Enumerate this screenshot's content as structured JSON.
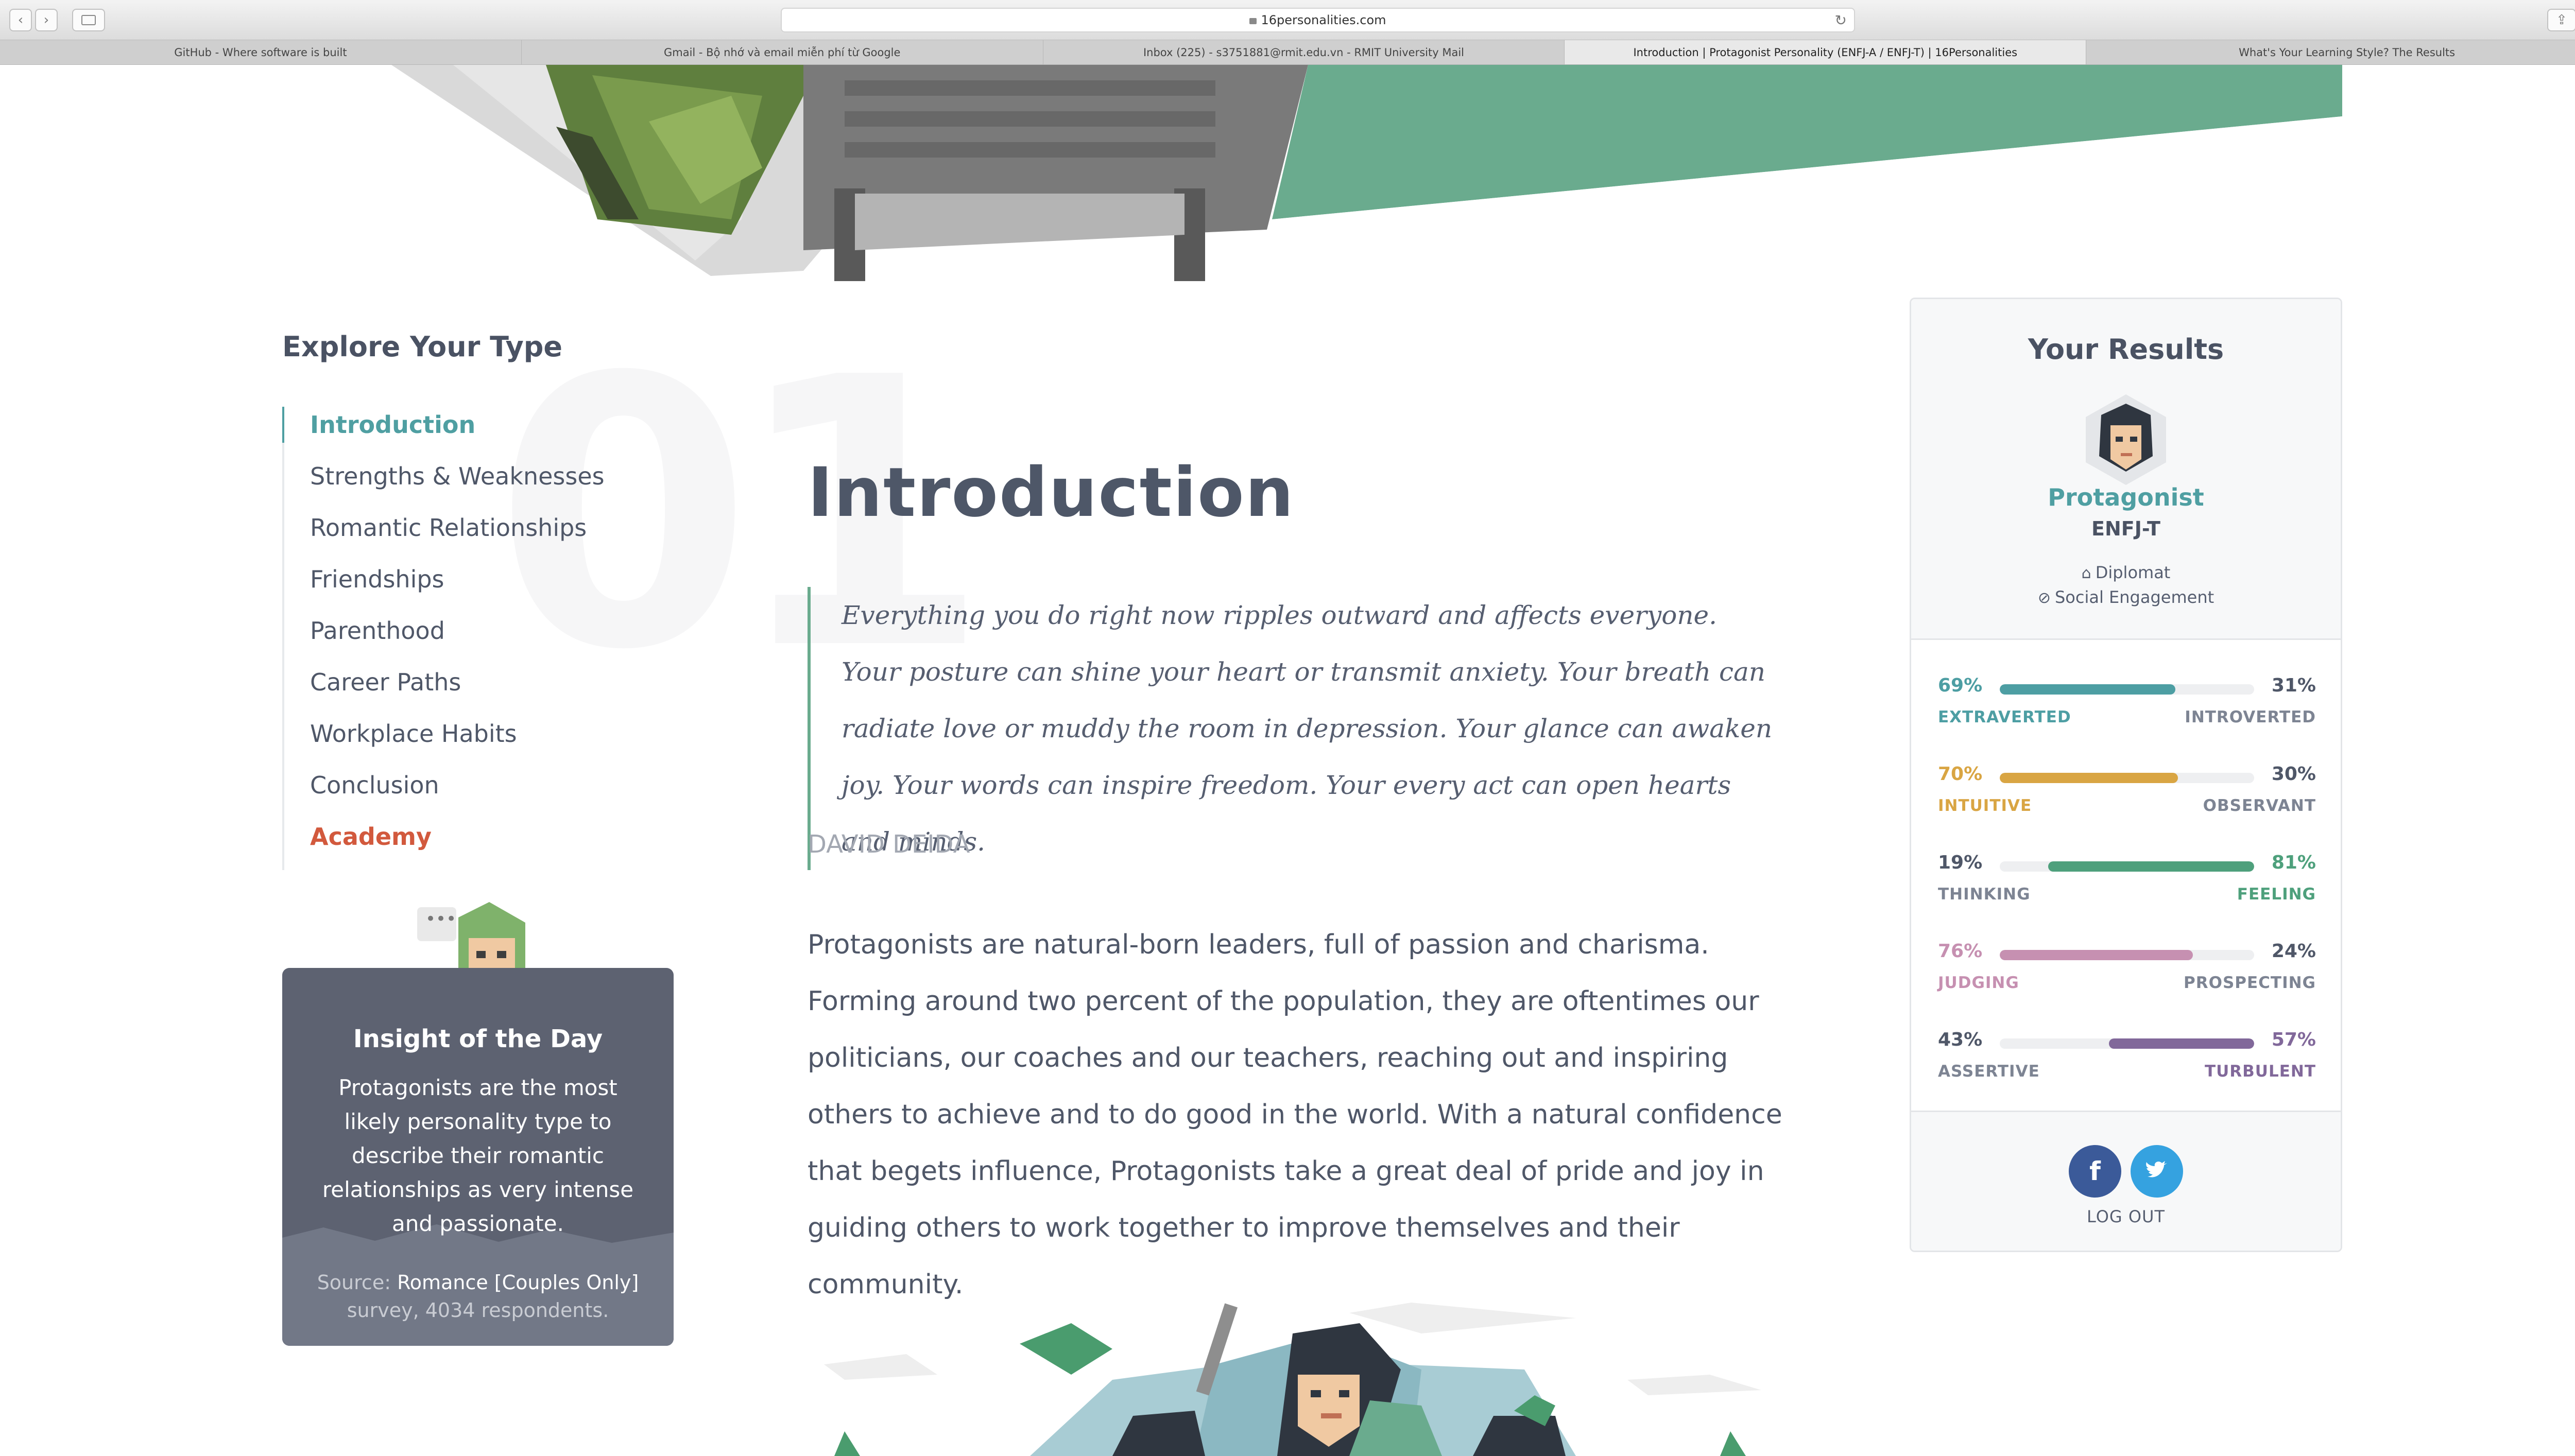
{
  "browser": {
    "url": "16personalities.com",
    "tabs": [
      {
        "label": "GitHub - Where software is built",
        "active": false
      },
      {
        "label": "Gmail - Bộ nhớ và email miễn phí từ Google",
        "active": false
      },
      {
        "label": "Inbox (225) - s3751881@rmit.edu.vn - RMIT University Mail",
        "active": false
      },
      {
        "label": "Introduction | Protagonist Personality (ENFJ-A / ENFJ-T) | 16Personalities",
        "active": true
      },
      {
        "label": "What's Your Learning Style? The Results",
        "active": false
      }
    ],
    "new_tab_label": "+"
  },
  "sidebar": {
    "title": "Explore Your Type",
    "section_number": "01",
    "items": [
      {
        "label": "Introduction",
        "active": true
      },
      {
        "label": "Strengths & Weaknesses"
      },
      {
        "label": "Romantic Relationships"
      },
      {
        "label": "Friendships"
      },
      {
        "label": "Parenthood"
      },
      {
        "label": "Career Paths"
      },
      {
        "label": "Workplace Habits"
      },
      {
        "label": "Conclusion"
      },
      {
        "label": "Academy",
        "accent": true
      }
    ]
  },
  "insight": {
    "title": "Insight of the Day",
    "text": "Protagonists are the most likely personality type to describe their romantic relationships as very intense and passionate.",
    "source_prefix": "Source:",
    "source_link": "Romance [Couples Only]",
    "source_suffix": "survey, 4034 respondents."
  },
  "main": {
    "title": "Introduction",
    "quote": "Everything you do right now ripples outward and affects everyone. Your posture can shine your heart or transmit anxiety. Your breath can radiate love or muddy the room in depression. Your glance can awaken joy. Your words can inspire freedom. Your every act can open hearts and minds.",
    "quote_author": "DAVID DEIDA",
    "body": "Protagonists are natural-born leaders, full of passion and charisma. Forming around two percent of the population, they are oftentimes our politicians, our coaches and our teachers, reaching out and inspiring others to achieve and to do good in the world. With a natural confidence that begets influence, Protagonists take a great deal of pride and joy in guiding others to work together to improve themselves and their community."
  },
  "results": {
    "title": "Your Results",
    "type_name": "Protagonist",
    "type_code": "ENFJ-T",
    "role": "Diplomat",
    "strategy": "Social Engagement",
    "traits": [
      {
        "left_pct": "69%",
        "right_pct": "31%",
        "left_label": "EXTRAVERTED",
        "right_label": "INTROVERTED",
        "dominant": "left",
        "fill_fraction": 0.69,
        "color": "#4d9ea3"
      },
      {
        "left_pct": "70%",
        "right_pct": "30%",
        "left_label": "INTUITIVE",
        "right_label": "OBSERVANT",
        "dominant": "left",
        "fill_fraction": 0.7,
        "color": "#d9a543"
      },
      {
        "left_pct": "19%",
        "right_pct": "81%",
        "left_label": "THINKING",
        "right_label": "FEELING",
        "dominant": "right",
        "fill_fraction": 0.81,
        "color": "#4ea07c"
      },
      {
        "left_pct": "76%",
        "right_pct": "24%",
        "left_label": "JUDGING",
        "right_label": "PROSPECTING",
        "dominant": "left",
        "fill_fraction": 0.76,
        "color": "#c690b1"
      },
      {
        "left_pct": "43%",
        "right_pct": "57%",
        "left_label": "ASSERTIVE",
        "right_label": "TURBULENT",
        "dominant": "right",
        "fill_fraction": 0.57,
        "color": "#81689a"
      }
    ],
    "facebook_label": "f",
    "twitter_icon": "twitter-bird-icon",
    "logout": "LOG OUT"
  },
  "colors": {
    "accent_teal": "#4f9fa2",
    "academy_red": "#d2593d",
    "hero_green": "#6aab8e",
    "neutral_text": "#565e70"
  }
}
